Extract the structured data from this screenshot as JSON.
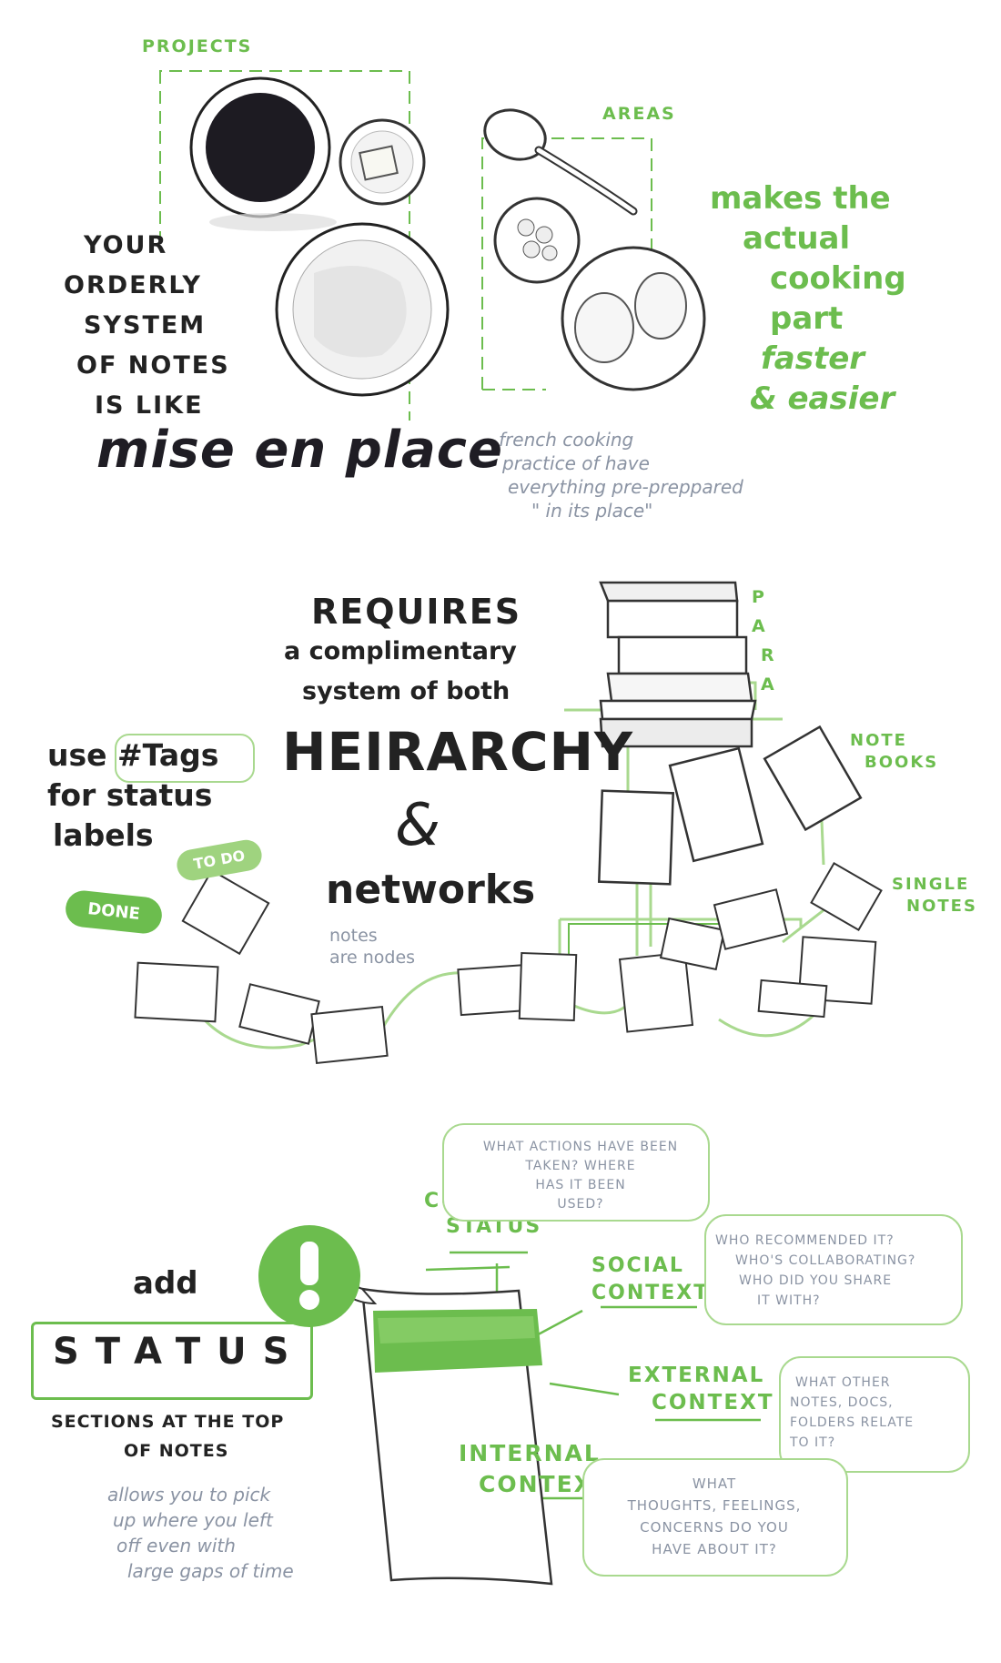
{
  "section1": {
    "projects_label": "PROJECTS",
    "areas_label": "AREAS",
    "intro_lines": [
      "YOUR",
      "ORDERLY",
      "SYSTEM",
      "OF NOTES",
      "IS LIKE"
    ],
    "title": "mise en place",
    "definition_lines": [
      "french cooking",
      "practice of have",
      "everything pre-preppared",
      "\" in its place\""
    ],
    "benefit_lines": [
      "makes the",
      "actual",
      "cooking",
      "part",
      "faster",
      "& easier"
    ]
  },
  "section2": {
    "requires_lines": [
      "REQUIRES",
      "a complimentary",
      "system of both"
    ],
    "hierarchy": "HEIRARCHY",
    "ampersand": "&",
    "networks": "networks",
    "nodes_lines": [
      "notes",
      "are nodes"
    ],
    "tags_lines": [
      "use #Tags",
      "for status",
      "labels"
    ],
    "todo_label": "TO DO",
    "done_label": "DONE",
    "para_letters": [
      "P",
      "A",
      "R",
      "A"
    ],
    "notebooks_lines": [
      "NOTE",
      "BOOKS"
    ],
    "single_notes_lines": [
      "SINGLE",
      "NOTES"
    ]
  },
  "section3": {
    "add": "add",
    "status": "STATUS",
    "sections_lines": [
      "SECTIONS AT THE TOP",
      "OF NOTES"
    ],
    "allows_lines": [
      "allows you to pick",
      "up where you left",
      "off even with",
      "large gaps of time"
    ],
    "current_status_lines": [
      "CURRENT",
      "STATUS"
    ],
    "current_status_q": [
      "WHAT ACTIONS HAVE BEEN",
      "TAKEN? WHERE",
      "HAS IT BEEN",
      "USED?"
    ],
    "social_context_lines": [
      "SOCIAL",
      "CONTEXT"
    ],
    "social_context_q": [
      "WHO RECOMMENDED IT?",
      "WHO'S COLLABORATING?",
      "WHO DID YOU SHARE",
      "IT WITH?"
    ],
    "external_context_lines": [
      "EXTERNAL",
      "CONTEXT"
    ],
    "external_context_q": [
      "WHAT OTHER",
      "NOTES, DOCS,",
      "FOLDERS RELATE",
      "TO IT?"
    ],
    "internal_context_lines": [
      "INTERNAL",
      "CONTEXT"
    ],
    "internal_context_q": [
      "WHAT",
      "THOUGHTS, FEELINGS,",
      "CONCERNS DO YOU",
      "HAVE ABOUT IT?"
    ]
  },
  "colors": {
    "accent": "#6cbd4e",
    "light_accent": "#a9d98f",
    "gray_text": "#8a93a3",
    "ink": "#222222"
  }
}
